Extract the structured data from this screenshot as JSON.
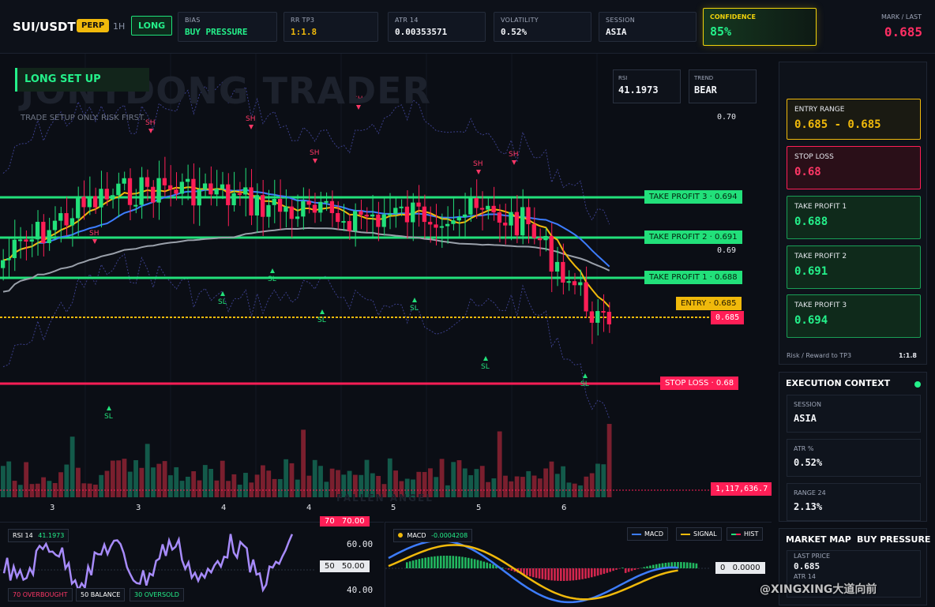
{
  "header": {
    "pair": "SUI/USDT",
    "perp": "PERP",
    "timeframe": "1H",
    "direction": "LONG",
    "cards": [
      {
        "label": "BIAS",
        "value": "BUY PRESSURE",
        "color": "#24f08a"
      },
      {
        "label": "RR TP3",
        "value": "1:1.8",
        "color": "#f0b90b"
      },
      {
        "label": "ATR 14",
        "value": "0.00353571",
        "color": "#f2f4f8"
      },
      {
        "label": "VOLATILITY",
        "value": "0.52%",
        "color": "#f2f4f8"
      },
      {
        "label": "SESSION",
        "value": "ASIA",
        "color": "#f2f4f8"
      }
    ],
    "confidence_label": "CONFIDENCE",
    "confidence_value": "85%",
    "mark_label": "MARK / LAST",
    "mark_value": "0.685"
  },
  "chart": {
    "watermark": "JONYDONG TRADER",
    "tagline": "TRADE SETUP ONLY. RISK FIRST.",
    "rsi_label": "RSI",
    "rsi_value": "41.1973",
    "trend_label": "TREND",
    "trend_value": "BEAR",
    "y_labels": [
      "0.70",
      "0.69"
    ],
    "tp3_tag": "TAKE PROFIT 3 · 0.694",
    "tp2_tag": "TAKE PROFIT 2 · 0.691",
    "tp1_tag": "TAKE PROFIT 1 · 0.688",
    "entry_tag": "ENTRY · 0.685",
    "last_tag": "0.685",
    "sl_tag": "STOP LOSS · 0.68",
    "volume_tag": "1,117,636.7",
    "x_labels": [
      "3",
      "3",
      "4",
      "4",
      "5",
      "5",
      "6"
    ],
    "sh_label": "SH",
    "sl_label": "SL",
    "fallen_watermark": "FALLEN ANGEL",
    "colors": {
      "bull": "#22e07a",
      "bear": "#ff1e56",
      "tp": "#22e07a",
      "sl": "#ff1e56",
      "entry": "#f0b90b"
    }
  },
  "rsi_panel": {
    "label": "RSI 14",
    "value": "41.1973",
    "levels": [
      "70.00",
      "60.00",
      "50.00",
      "40.00"
    ],
    "level_70_tag": "70",
    "level_50_tag": "50",
    "chips": [
      "70 OVERBOUGHT",
      "50 BALANCE",
      "30 OVERSOLD"
    ]
  },
  "macd_panel": {
    "label": "MACD",
    "value": "-0.0004208",
    "legend": [
      "MACD",
      "SIGNAL",
      "HIST"
    ],
    "zero_tag": "0",
    "zero_value": "0.0000"
  },
  "setup": {
    "title": "LONG SET UP",
    "entry_label": "ENTRY RANGE",
    "entry_value": "0.685 - 0.685",
    "sl_label": "STOP LOSS",
    "sl_value": "0.68",
    "tp1_label": "TAKE PROFIT 1",
    "tp1_value": "0.688",
    "tp2_label": "TAKE PROFIT 2",
    "tp2_value": "0.691",
    "tp3_label": "TAKE PROFIT 3",
    "tp3_value": "0.694",
    "rr_label": "Risk / Reward to TP3",
    "rr_value": "1:1.8"
  },
  "execution": {
    "title": "EXECUTION CONTEXT",
    "session_label": "SESSION",
    "session_value": "ASIA",
    "atr_label": "ATR %",
    "atr_value": "0.52%",
    "range_label": "RANGE 24",
    "range_value": "2.13%"
  },
  "market_map": {
    "title": "MARKET MAP",
    "bias": "BUY PRESSURE",
    "last_label": "LAST PRICE",
    "last_value": "0.685",
    "atr_label": "ATR 14"
  },
  "credit": "@XINGXING大道向前"
}
